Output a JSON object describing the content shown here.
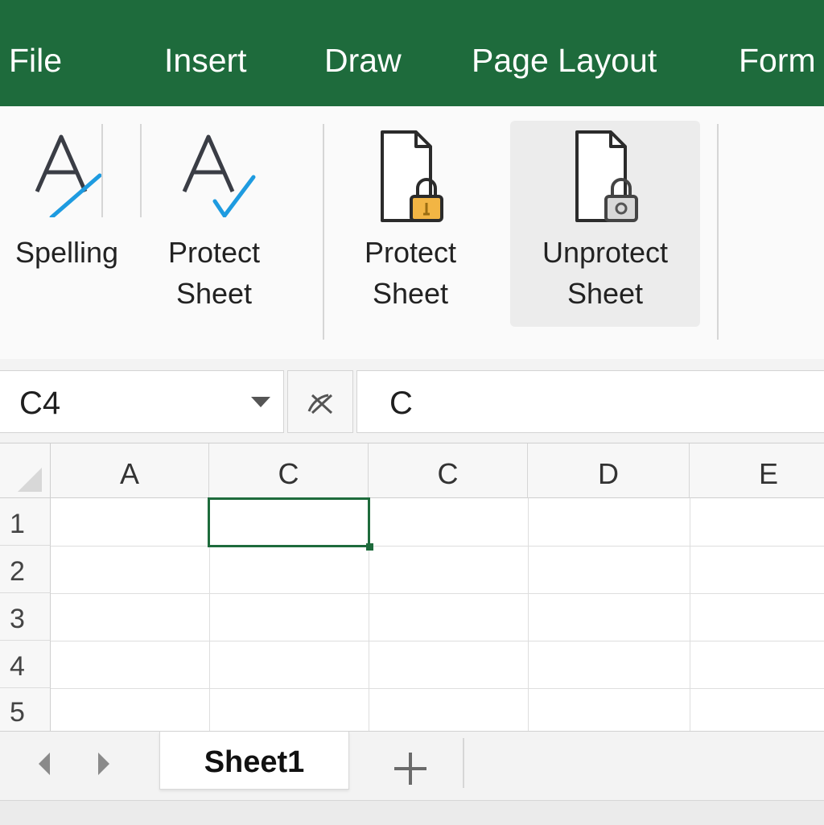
{
  "menu": {
    "items": [
      {
        "label": "File"
      },
      {
        "label": "Insert"
      },
      {
        "label": "Draw"
      },
      {
        "label": "Page Layout"
      },
      {
        "label": "Form"
      }
    ]
  },
  "ribbon": {
    "buttons": [
      {
        "line1": "Spelling",
        "line2": "",
        "icon": "spelling-icon"
      },
      {
        "line1": "Protect",
        "line2": "Sheet",
        "icon": "spelling-check-icon"
      },
      {
        "line1": "Protect",
        "line2": "Sheet",
        "icon": "document-lock-icon"
      },
      {
        "line1": "Unprotect",
        "line2": "Sheet",
        "icon": "document-unlock-icon",
        "active": true
      }
    ]
  },
  "formula_bar": {
    "name_box": "C4",
    "formula": "C",
    "fx_icon": "function-icon"
  },
  "grid": {
    "columns": [
      "A",
      "C",
      "C",
      "D",
      "E"
    ],
    "rows": [
      "1",
      "2",
      "3",
      "4",
      "5"
    ],
    "selected_cell": {
      "row": 1,
      "col": 2
    }
  },
  "sheets": {
    "tabs": [
      {
        "label": "Sheet1",
        "active": true
      }
    ],
    "add_label": "+"
  },
  "colors": {
    "brand_green": "#1e6b3c",
    "lock_gold": "#f2b544",
    "check_blue": "#1e9be0"
  }
}
